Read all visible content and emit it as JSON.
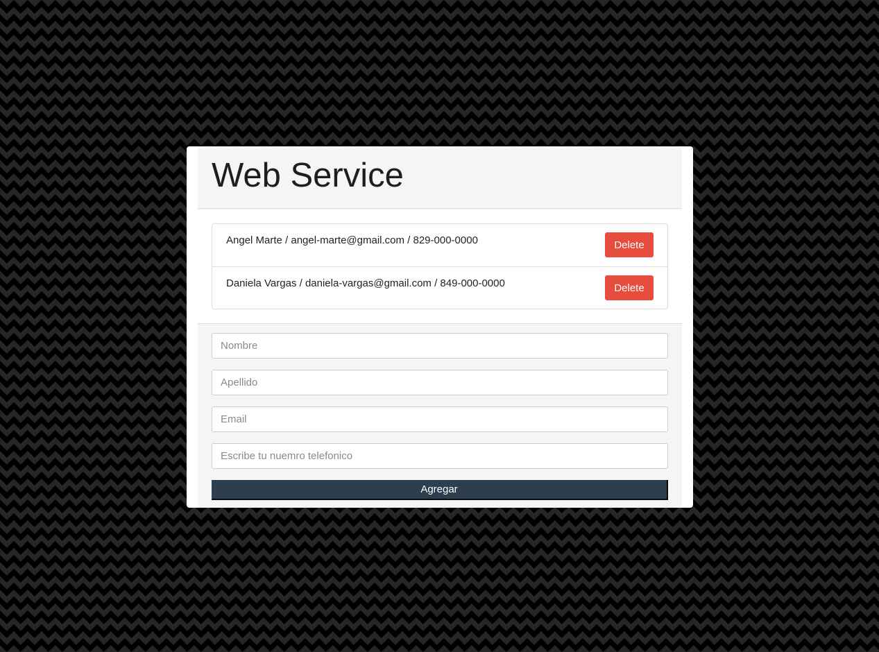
{
  "app": {
    "title": "Web Service"
  },
  "contacts": [
    {
      "text": "Angel Marte / angel-marte@gmail.com / 829-000-0000",
      "delete_label": "Delete"
    },
    {
      "text": "Daniela Vargas / daniela-vargas@gmail.com / 849-000-0000",
      "delete_label": "Delete"
    }
  ],
  "form": {
    "nombre_placeholder": "Nombre",
    "apellido_placeholder": "Apellido",
    "email_placeholder": "Email",
    "telefono_placeholder": "Escribe tu nuemro telefonico",
    "submit_label": "Agregar"
  },
  "colors": {
    "delete_button": "#e74c3c",
    "submit_button": "#2c3e50",
    "background": "#000000",
    "pattern": "#262626"
  }
}
